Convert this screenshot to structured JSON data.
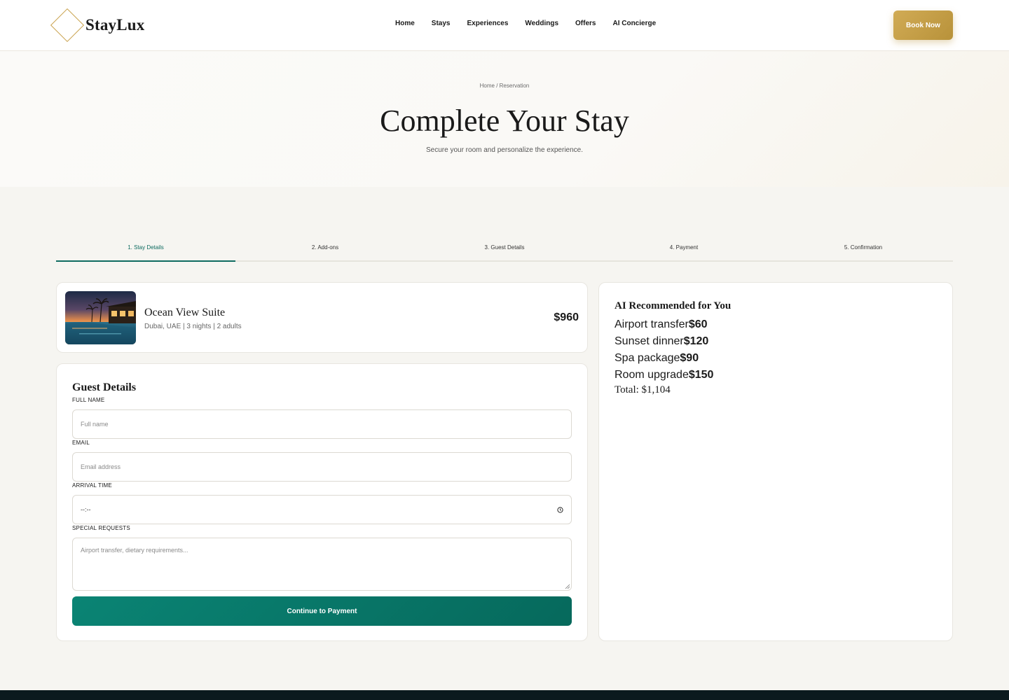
{
  "brand": {
    "name": "StayLux",
    "logo_icon": "diamond-outline-icon",
    "accent": "#c9a24d"
  },
  "nav": {
    "items": [
      {
        "label": "Home"
      },
      {
        "label": "Stays"
      },
      {
        "label": "Experiences"
      },
      {
        "label": "Weddings"
      },
      {
        "label": "Offers"
      },
      {
        "label": "AI Concierge"
      }
    ],
    "cta": "Book Now"
  },
  "hero": {
    "breadcrumb": "Home / Reservation",
    "title": "Complete Your Stay",
    "subtitle": "Secure your room and personalize the experience."
  },
  "steps": [
    {
      "label": "1. Stay Details",
      "active": true
    },
    {
      "label": "2. Add-ons",
      "active": false
    },
    {
      "label": "3. Guest Details",
      "active": false
    },
    {
      "label": "4. Payment",
      "active": false
    },
    {
      "label": "5. Confirmation",
      "active": false
    }
  ],
  "room": {
    "name": "Ocean View Suite",
    "meta": "Dubai, UAE | 3 nights | 2 adults",
    "price": "$960",
    "image": "infinity-pool-sunset-photo"
  },
  "form": {
    "title": "Guest Details",
    "full_name": {
      "label": "FULL NAME",
      "placeholder": "Full name",
      "value": ""
    },
    "email": {
      "label": "EMAIL",
      "placeholder": "Email address",
      "value": ""
    },
    "arrival": {
      "label": "ARRIVAL TIME",
      "value": "--:--",
      "icon": "clock-icon"
    },
    "requests": {
      "label": "SPECIAL REQUESTS",
      "placeholder": "Airport transfer, dietary requirements...",
      "value": ""
    },
    "submit": "Continue to Payment",
    "submit_color": "#0a8474"
  },
  "ai": {
    "title": "AI Recommended for You",
    "items": [
      {
        "name": "Airport transfer",
        "price": "$60"
      },
      {
        "name": "Sunset dinner",
        "price": "$120"
      },
      {
        "name": "Spa package",
        "price": "$90"
      },
      {
        "name": "Room upgrade",
        "price": "$150"
      }
    ],
    "total": "Total: $1,104"
  }
}
